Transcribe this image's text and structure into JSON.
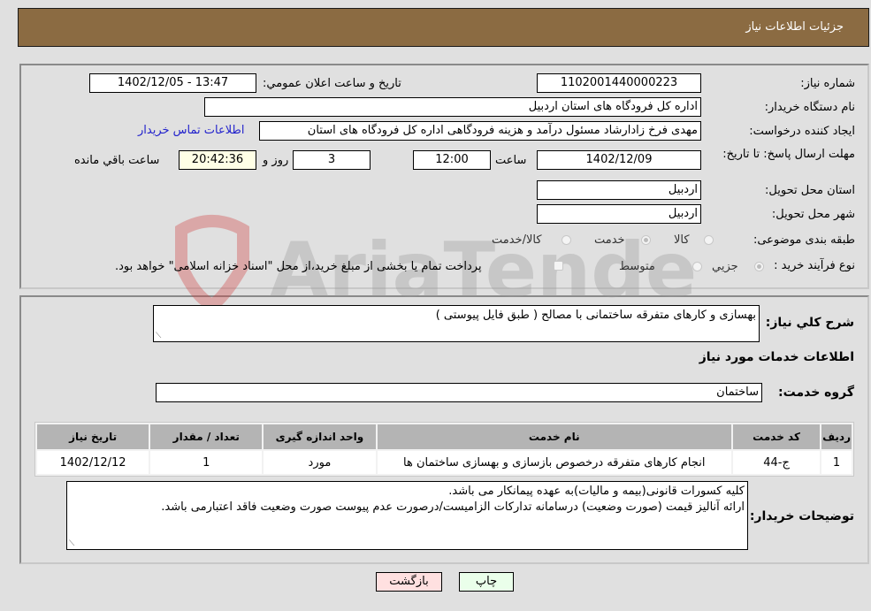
{
  "header": {
    "title": "جزئيات اطلاعات نياز"
  },
  "fields": {
    "need_number": {
      "label": "شماره نياز:",
      "value": "1102001440000223"
    },
    "announce": {
      "label": "تاريخ و ساعت اعلان عمومي:",
      "value": "1402/12/05 - 13:47"
    },
    "buyer_org": {
      "label": "نام دستگاه خريدار:",
      "value": "اداره کل فرودگاه های استان اردبیل"
    },
    "creator": {
      "label": "ايجاد کننده درخواست:",
      "value": "مهدی فرخ زادارشاد مسئول درآمد و هزینه فرودگاهی اداره کل فرودگاه های استان"
    },
    "contact_link": "اطلاعات تماس خريدار",
    "deadline": {
      "label": "مهلت ارسال پاسخ: تا تاريخ:",
      "date": "1402/12/09",
      "time_label": "ساعت",
      "time": "12:00",
      "days": "3",
      "days_label": "روز و",
      "remaining": "20:42:36",
      "remaining_label": "ساعت باقي مانده"
    },
    "province": {
      "label": "استان محل تحويل:",
      "value": "اردبیل"
    },
    "city": {
      "label": "شهر محل تحويل:",
      "value": "اردبیل"
    },
    "category": {
      "label": "طبقه بندی موضوعی:",
      "options": [
        "کالا",
        "خدمت",
        "کالا/خدمت"
      ],
      "selected": "خدمت"
    },
    "process": {
      "label": "نوع فرآيند خريد :",
      "options": [
        "جزيي",
        "متوسط"
      ],
      "selected": "جزيي",
      "treasury_note": "پرداخت تمام يا بخشی از مبلغ خريد،از محل \"اسناد خزانه اسلامی\" خواهد بود."
    }
  },
  "description": {
    "label": "شرح کلي نياز:",
    "value": "بهسازی و کارهای متفرقه ساختمانی با مصالح ( طبق فایل پیوستی )"
  },
  "services_title": "اطلاعات خدمات مورد نياز",
  "service_group": {
    "label": "گروه خدمت:",
    "value": "ساختمان"
  },
  "table": {
    "headers": [
      "رديف",
      "کد خدمت",
      "نام خدمت",
      "واحد اندازه گيری",
      "تعداد / مقدار",
      "تاريخ نياز"
    ],
    "rows": [
      [
        "1",
        "ج-44",
        "انجام کارهای متفرقه درخصوص بازسازی و بهسازی ساختمان ها",
        "مورد",
        "1",
        "1402/12/12"
      ]
    ]
  },
  "buyer_notes": {
    "label": "توضيحات خريدار:",
    "lines": [
      "کلیه کسورات قانونی(بیمه و مالیات)به عهده پیمانکار می باشد.",
      "ارائه آنالیز قیمت (صورت وضعیت) درسامانه تدارکات الزامیست/درصورت عدم پیوست صورت وضعیت فاقد اعتبارمی باشد."
    ]
  },
  "buttons": {
    "print": "چاپ",
    "back": "بازگشت"
  },
  "watermark": "AriaTender.neT",
  "colors": {
    "header_bg": "#8b6b42",
    "print_bg": "#eaffea",
    "back_bg": "#ffe0e0",
    "link": "#2222cc"
  }
}
